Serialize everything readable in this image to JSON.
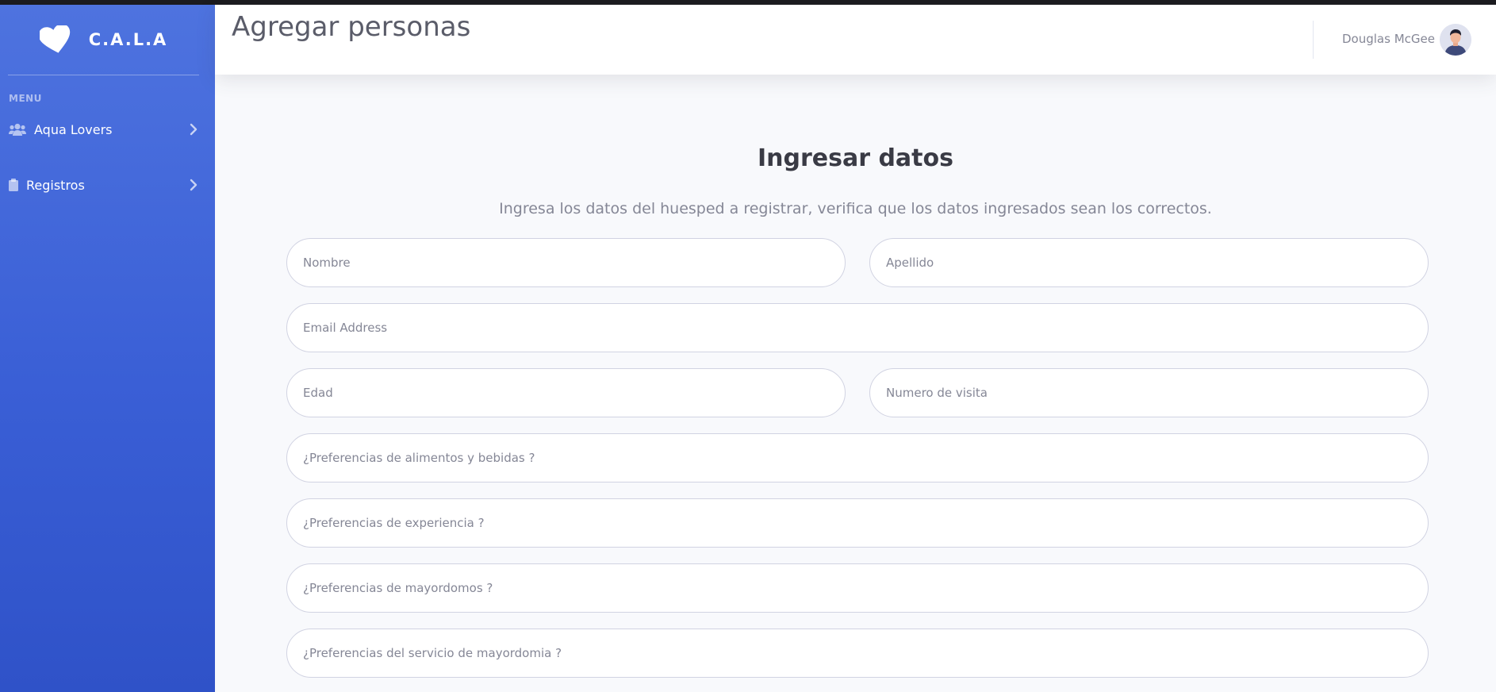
{
  "app": {
    "brand_name": "C.A.L.A",
    "page_title": "Agregar personas"
  },
  "sidebar": {
    "menu_heading": "MENU",
    "items": [
      {
        "label": "Aqua Lovers",
        "icon": "users-icon"
      },
      {
        "label": "Registros",
        "icon": "clipboard-icon"
      }
    ]
  },
  "user": {
    "name": "Douglas McGee"
  },
  "form": {
    "title": "Ingresar datos",
    "subtitle": "Ingresa los datos del huesped a registrar, verifica que los datos ingresados sean los correctos.",
    "fields": {
      "nombre": {
        "placeholder": "Nombre",
        "value": ""
      },
      "apellido": {
        "placeholder": "Apellido",
        "value": ""
      },
      "email": {
        "placeholder": "Email Address",
        "value": ""
      },
      "edad": {
        "placeholder": "Edad",
        "value": ""
      },
      "visita": {
        "placeholder": "Numero de visita",
        "value": ""
      },
      "alimentos": {
        "placeholder": "¿Preferencias de alimentos y bebidas ?",
        "value": ""
      },
      "experiencia": {
        "placeholder": "¿Preferencias de experiencia ?",
        "value": ""
      },
      "mayordomos": {
        "placeholder": "¿Preferencias de mayordomos ?",
        "value": ""
      },
      "servicio": {
        "placeholder": "¿Preferencias del servicio de mayordomia ?",
        "value": ""
      }
    }
  },
  "colors": {
    "sidebar_top": "#4e73df",
    "sidebar_bottom": "#2f52c8",
    "background": "#f8f9fc",
    "text_muted": "#858796"
  }
}
